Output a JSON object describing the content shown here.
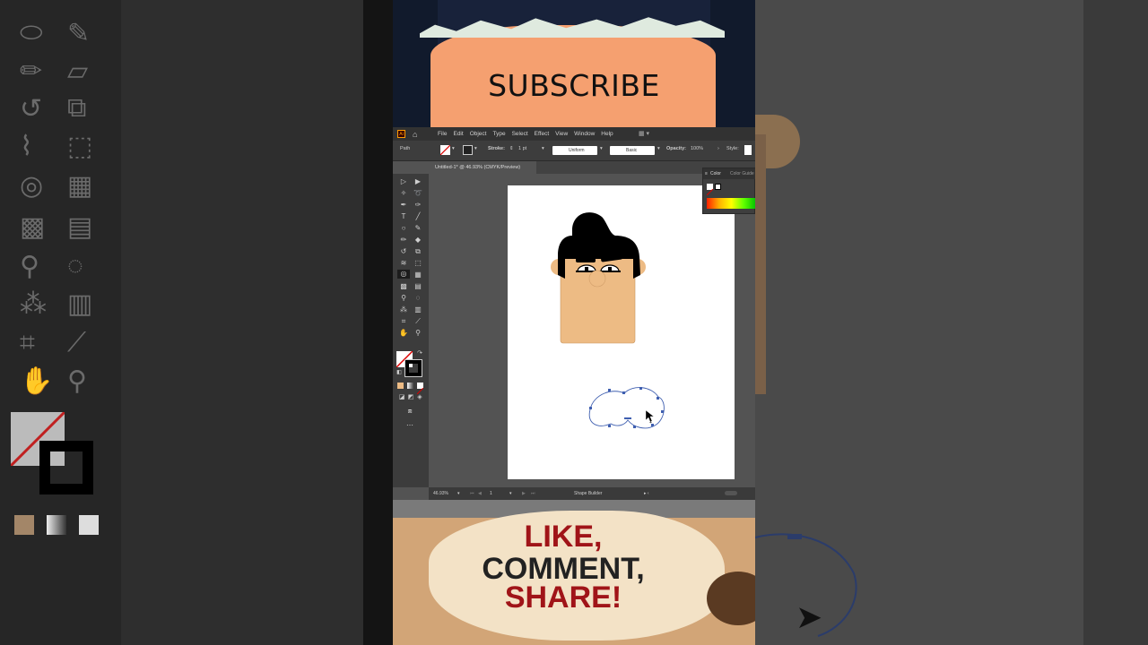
{
  "subscribe_banner": {
    "text": "SUBSCRIBE"
  },
  "like_banner": {
    "line1": "LIKE,",
    "line2": "COMMENT,",
    "line3": "SHARE!"
  },
  "colors": {
    "accent_red": "#a01418",
    "dark_text": "#222222",
    "banner_orange": "#f5a070",
    "skin": "#edbb84"
  },
  "app": {
    "logo": "Ai",
    "menus": [
      "File",
      "Edit",
      "Object",
      "Type",
      "Select",
      "Effect",
      "View",
      "Window",
      "Help"
    ],
    "control": {
      "selection": "Path",
      "stroke_label": "Stroke:",
      "stroke_weight": "1 pt",
      "profile": "Uniform",
      "brush": "Basic",
      "opacity_label": "Opacity:",
      "opacity": "100%",
      "style_label": "Style:"
    },
    "doc_tab": "Untitled-1* @ 46.93% (CMYK/Preview)",
    "color_panel": {
      "tab1": "Color",
      "tab2": "Color Guide"
    },
    "status": {
      "zoom": "46.93%",
      "artboard": "1",
      "tool": "Shape Builder"
    }
  }
}
